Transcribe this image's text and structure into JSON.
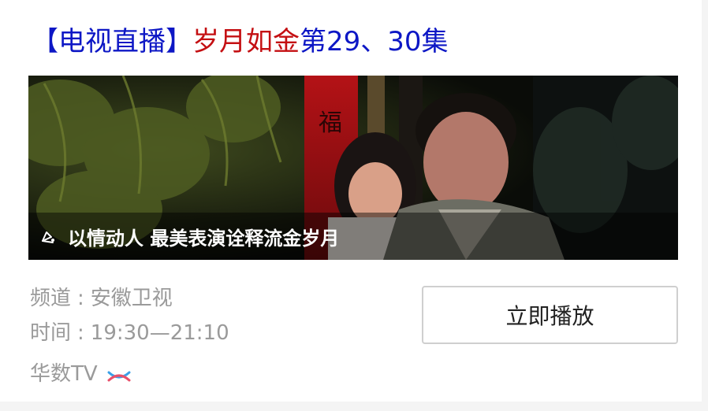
{
  "title": {
    "prefix": "【电视直播】",
    "show_name": "岁月如金",
    "episodes": "第29、30集"
  },
  "hero": {
    "caption": "以情动人 最美表演诠释流金岁月",
    "caption_icon": "play-bell-icon",
    "banner_text": "福"
  },
  "meta": {
    "channel_label": "频道",
    "channel_value": "安徽卫视",
    "time_label": "时间",
    "time_value": "19:30—21:10",
    "separator": ":"
  },
  "source": {
    "name": "华数TV",
    "logo_icon": "huashu-logo-icon"
  },
  "play_button": {
    "label": "立即播放"
  },
  "colors": {
    "title_blue": "#0d17c5",
    "title_red": "#c40f12",
    "meta_gray": "#9a9a9a"
  }
}
